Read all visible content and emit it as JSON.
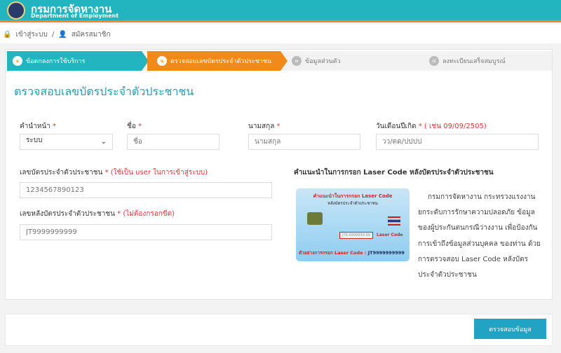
{
  "header": {
    "title": "กรมการจัดหางาน",
    "subtitle": "Department of Employment"
  },
  "breadcrumb": [
    {
      "label": "เข้าสู่ระบบ",
      "icon": "lock-icon"
    },
    {
      "label": "สมัครสมาชิก",
      "icon": "user-icon"
    }
  ],
  "steps": [
    {
      "num": "๑",
      "label": "ข้อตกลงการใช้บริการ",
      "state": "done"
    },
    {
      "num": "๒",
      "label": "ตรวจสอบเลขบัตรประจำตัวประชาชน",
      "state": "active"
    },
    {
      "num": "๓",
      "label": "ข้อมูลส่วนตัว",
      "state": "pending"
    },
    {
      "num": "๔",
      "label": "ลงทะเบียนเสร็จสมบูรณ์",
      "state": "pending"
    }
  ],
  "form": {
    "title": "ตรวจสอบเลขบัตรประจำตัวประชาชน",
    "prefix": {
      "label": "คำนำหน้า",
      "value": "ระบบ"
    },
    "first_name": {
      "label": "ชื่อ",
      "placeholder": "ชื่อ"
    },
    "last_name": {
      "label": "นามสกุล",
      "placeholder": "นามสกุล"
    },
    "dob": {
      "label": "วันเดือนปีเกิด",
      "hint": "( เช่น 09/09/2505)",
      "placeholder": "วว/ดด/ปปปป"
    },
    "id_card": {
      "label": "เลขบัตรประจำตัวประชาชน",
      "hint": "(ใช้เป็น user ในการเข้าสู่ระบบ)",
      "placeholder": "1234567890123"
    },
    "laser": {
      "label": "เลขหลังบัตรประจำตัวประชาชน",
      "hint": "(ไม่ต้องกรอกขีด)",
      "placeholder": "JT9999999999"
    },
    "required": "*"
  },
  "help": {
    "title": "คำแนะนำในการกรอก Laser Code หลังบัตรประจำตัวประชาชน",
    "card": {
      "line1": "คำแนะนำในการกรอก Laser Code",
      "line2": "หลังบัตรประจำตัวประชาชน",
      "code": "JT9-9999999-99",
      "code_label": "Laser Code",
      "example": "ตัวอย่างการกรอก Laser Code :",
      "example_value": "JT9999999999"
    },
    "description": "กรมการจัดหางาน กระทรวงแรงงาน ยกระดับการรักษาความปลอดภัย ข้อมูลของผู้ประกันตนกรณีว่างงาน เพื่อป้องกันการเข้าถึงข้อมูลส่วนบุคคล ของท่าน ด้วยการตรวจสอบ Laser Code หลังบัตรประจำตัวประชาชน"
  },
  "footer": {
    "submit_label": "ตรวจสอบข้อมูล"
  },
  "colors": {
    "primary": "#22b4bf",
    "accent": "#f28a1a",
    "required": "#d9363e",
    "button": "#22a3c4"
  }
}
